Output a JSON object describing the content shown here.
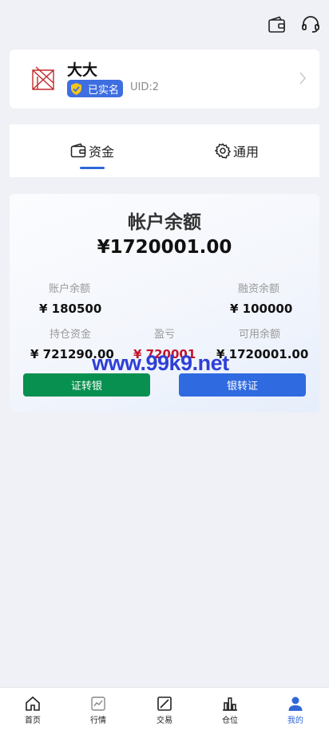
{
  "header": {
    "icons": [
      "wallet-icon",
      "headset-icon"
    ]
  },
  "profile": {
    "name": "大大",
    "verified_label": "已实名",
    "uid": "UID:2",
    "avatar_color": "#c32a2a"
  },
  "tabs": [
    {
      "label": "资金",
      "icon": "wallet-icon",
      "active": true
    },
    {
      "label": "通用",
      "icon": "gear-icon",
      "active": false
    }
  ],
  "balance": {
    "title": "帐户余额",
    "total": "¥1720001.00",
    "stats": [
      {
        "label": "账户余额",
        "value": "¥ 180500"
      },
      {
        "label": "融资余额",
        "value": "¥ 100000"
      },
      {
        "label": "持仓资金",
        "value": "¥ 721290.00"
      },
      {
        "label": "盈亏",
        "value": "¥ 720001"
      },
      {
        "label": "可用余额",
        "value": "¥ 1720001.00"
      }
    ],
    "buttons": {
      "securities_to_bank": "证转银",
      "bank_to_securities": "银转证"
    }
  },
  "watermark": "www.99k9.net",
  "nav": [
    {
      "label": "首页",
      "icon": "home-icon"
    },
    {
      "label": "行情",
      "icon": "chart-icon"
    },
    {
      "label": "交易",
      "icon": "trade-icon"
    },
    {
      "label": "仓位",
      "icon": "bar-chart-icon"
    },
    {
      "label": "我的",
      "icon": "user-icon",
      "active": true
    }
  ],
  "colors": {
    "accent": "#2f66d8",
    "green": "#07904f",
    "loss_red": "#c4122b",
    "background": "#eff1f6"
  }
}
